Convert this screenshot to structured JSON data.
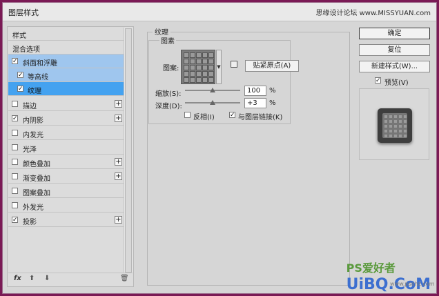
{
  "window": {
    "title": "图层样式",
    "watermark_top": "思缘设计论坛 www.MISSYUAN.com"
  },
  "left_list": {
    "header": "样式",
    "items": [
      {
        "label": "混合选项",
        "checkbox": false,
        "plus": false
      },
      {
        "label": "斜面和浮雕",
        "checkbox": true,
        "checked": true,
        "plus": false,
        "selected": "light"
      },
      {
        "label": "等高线",
        "checkbox": true,
        "checked": true,
        "plus": false,
        "sub": true,
        "selected": "light"
      },
      {
        "label": "纹理",
        "checkbox": true,
        "checked": true,
        "plus": false,
        "sub": true,
        "selected": "strong"
      },
      {
        "label": "描边",
        "checkbox": true,
        "checked": false,
        "plus": true
      },
      {
        "label": "内阴影",
        "checkbox": true,
        "checked": true,
        "plus": true
      },
      {
        "label": "内发光",
        "checkbox": true,
        "checked": false,
        "plus": false
      },
      {
        "label": "光泽",
        "checkbox": true,
        "checked": false,
        "plus": false
      },
      {
        "label": "颜色叠加",
        "checkbox": true,
        "checked": false,
        "plus": true
      },
      {
        "label": "渐变叠加",
        "checkbox": true,
        "checked": false,
        "plus": true
      },
      {
        "label": "图案叠加",
        "checkbox": true,
        "checked": false,
        "plus": false
      },
      {
        "label": "外发光",
        "checkbox": true,
        "checked": false,
        "plus": false
      },
      {
        "label": "投影",
        "checkbox": true,
        "checked": true,
        "plus": true
      }
    ],
    "footer": {
      "fx": "fx",
      "up": "⬆",
      "down": "⬇",
      "trash": "🗑"
    }
  },
  "texture": {
    "group_title": "纹理",
    "sub_title": "图素",
    "pattern_label": "图案:",
    "snap_button": "贴紧原点(A)",
    "scale_label": "缩放(S):",
    "scale_value": "100",
    "depth_label": "深度(D):",
    "depth_value": "+3",
    "percent": "%",
    "invert_label": "反相(I)",
    "invert_checked": false,
    "link_label": "与图层链接(K)",
    "link_checked": true,
    "scale_fraction": 0.5,
    "depth_fraction": 0.5
  },
  "right": {
    "ok": "确定",
    "reset": "复位",
    "new_style": "新建样式(W)...",
    "preview_label": "预览(V)",
    "preview_checked": true
  },
  "watermark_bottom": {
    "main": "UiBQ.CoM",
    "ps": "PS爱好者",
    "site": "www.psahz.com"
  },
  "colors": {
    "selected_light": "#9fc6ee",
    "selected_strong": "#44a2f0",
    "frame": "#7a1a55"
  }
}
